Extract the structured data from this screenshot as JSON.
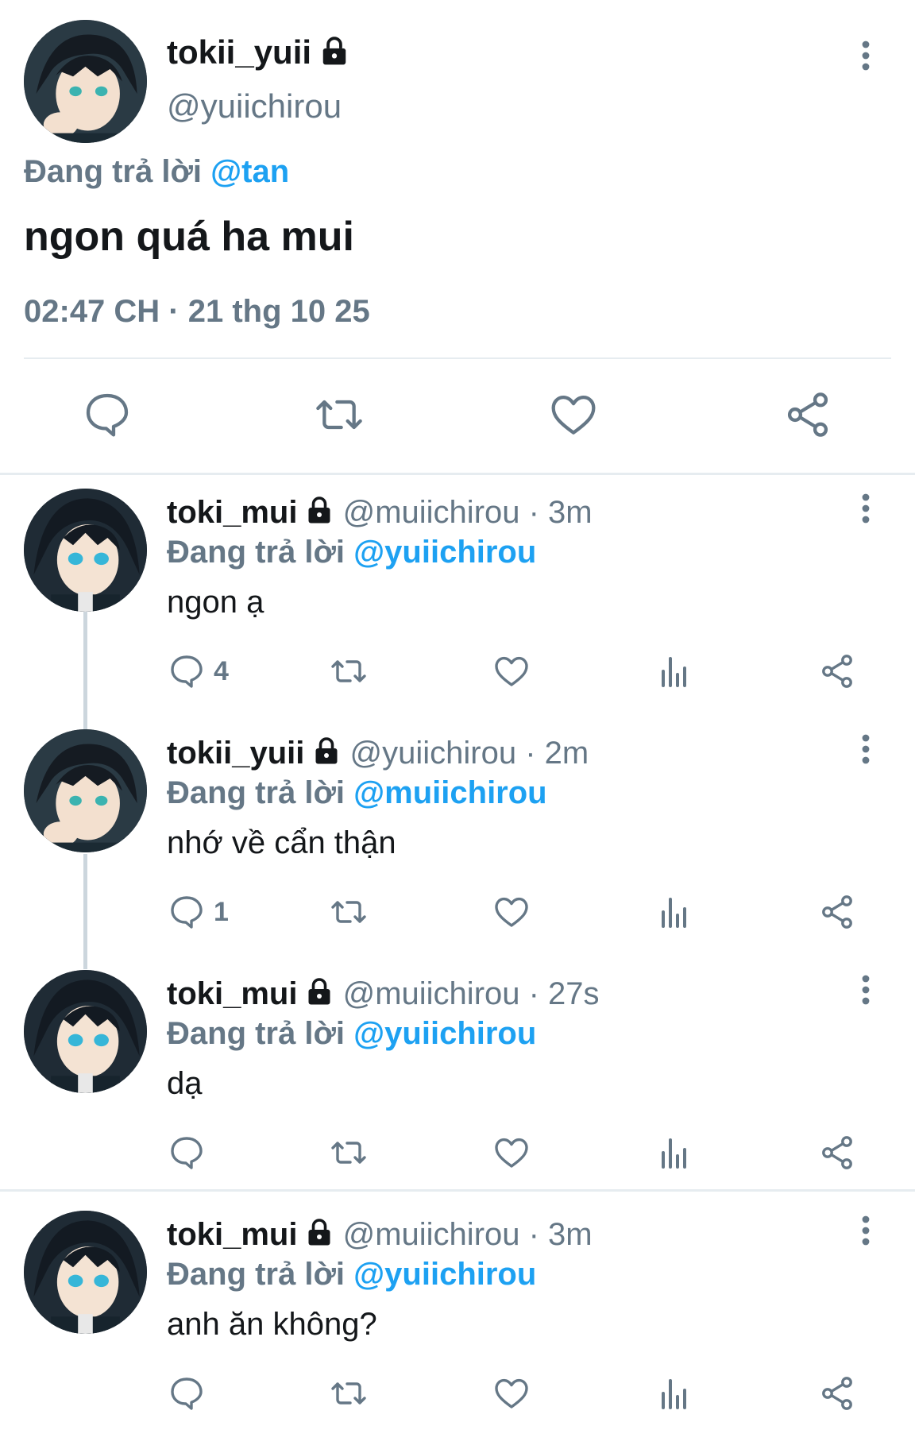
{
  "main_tweet": {
    "display_name": "tokii_yuii",
    "handle": "@yuiichirou",
    "replying_prefix": "Đang trả lời",
    "replying_to": "@tan",
    "text": "ngon quá ha mui",
    "timestamp": "02:47 CH · 21 thg 10 25",
    "actions": [
      "reply-icon",
      "retweet-icon",
      "like-icon",
      "share-icon"
    ]
  },
  "replies": [
    {
      "display_name": "toki_mui",
      "meta": "@muiichirou · 3m",
      "replying_prefix": "Đang trả lời",
      "replying_to": "@yuiichirou",
      "text": "ngon ạ",
      "reply_count": "4"
    },
    {
      "display_name": "tokii_yuii",
      "meta": "@yuiichirou · 2m",
      "replying_prefix": "Đang trả lời",
      "replying_to": "@muiichirou",
      "text": "nhớ về cẩn thận",
      "reply_count": "1"
    },
    {
      "display_name": "toki_mui",
      "meta": "@muiichirou · 27s",
      "replying_prefix": "Đang trả lời",
      "replying_to": "@yuiichirou",
      "text": "dạ",
      "reply_count": ""
    },
    {
      "display_name": "toki_mui",
      "meta": "@muiichirou · 3m",
      "replying_prefix": "Đang trả lời",
      "replying_to": "@yuiichirou",
      "text": "anh ăn không?",
      "reply_count": ""
    }
  ],
  "colors": {
    "link": "#1da1f2",
    "secondary_text": "#657786",
    "primary_text": "#14171a",
    "divider": "#e6ecf0"
  }
}
